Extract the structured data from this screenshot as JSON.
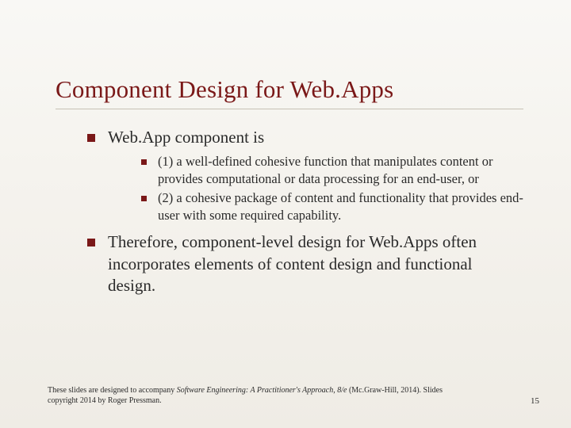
{
  "title": "Component Design for Web.Apps",
  "bullets": {
    "b1": "Web.App component is",
    "b1_1": "(1) a well-defined cohesive function that manipulates content or provides computational or data processing for an end-user, or",
    "b1_2": "(2) a cohesive package of content and functionality that provides end-user with some required capability.",
    "b2": "Therefore, component-level design for Web.Apps often incorporates elements of content design and functional design."
  },
  "footer": {
    "line1_pre": "These slides are designed to accompany ",
    "line1_em": "Software Engineering: A Practitioner's Approach, 8/e",
    "line2": " (Mc.Graw-Hill, 2014). Slides copyright 2014 by Roger Pressman."
  },
  "page_number": "15"
}
